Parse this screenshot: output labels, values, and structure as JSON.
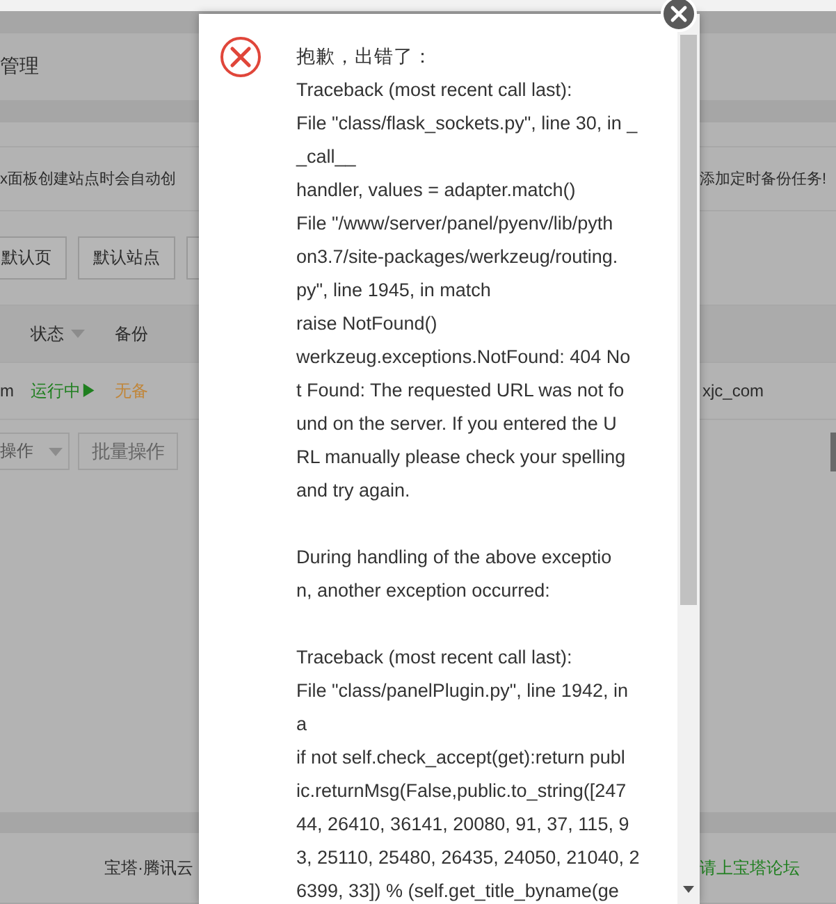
{
  "page": {
    "header": {
      "title": "管理"
    },
    "notice": {
      "left": "x面板创建站点时会自动创",
      "right": "添加定时备份任务!"
    },
    "toolbar": {
      "buttons": [
        "默认页",
        "默认站点"
      ]
    },
    "table": {
      "columns": [
        {
          "label": "状态",
          "sort_caret": true
        },
        {
          "label": "备份",
          "sort_caret": false
        }
      ],
      "rows": [
        {
          "column_1": "m",
          "status": "运行中▶",
          "backup": "无备",
          "column_right": "xjc_com"
        }
      ]
    },
    "batch": {
      "select": "操作",
      "button": "批量操作"
    },
    "footer": {
      "left": "宝塔·腾讯云",
      "right": "请上宝塔论坛"
    }
  },
  "dialog": {
    "paragraphs": [
      [
        "抱歉，出错了：",
        "Traceback (most recent call last):",
        "File \"class/flask_sockets.py\", line 30, in _",
        "_call__",
        "handler, values = adapter.match()",
        "File \"/www/server/panel/pyenv/lib/pyth",
        "on3.7/site-packages/werkzeug/routing.",
        "py\", line 1945, in match",
        "raise NotFound()",
        "werkzeug.exceptions.NotFound: 404 No",
        "t Found: The requested URL was not fo",
        "und on the server. If you entered the U",
        "RL manually please check your spelling",
        "and try again."
      ],
      [
        "During handling of the above exceptio",
        "n, another exception occurred:"
      ],
      [
        "Traceback (most recent call last):",
        "File \"class/panelPlugin.py\", line 1942, in",
        "a",
        "if not self.check_accept(get):return publ",
        "ic.returnMsg(False,public.to_string([247",
        "44, 26410, 36141, 20080, 91, 37, 115, 9",
        "3, 25110, 25480, 26435, 24050, 21040, 2",
        "6399, 33]) % (self.get_title_byname(ge"
      ]
    ]
  }
}
